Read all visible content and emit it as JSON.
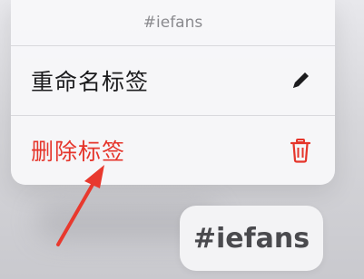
{
  "menu": {
    "header": "#iefans",
    "rename_label": "重命名标签",
    "rename_icon": "pencil-icon",
    "delete_label": "删除标签",
    "delete_icon": "trash-icon"
  },
  "tag_chip": {
    "label": "#iefans"
  },
  "colors": {
    "destructive": "#e5352b",
    "primary_text": "#1c1c1e",
    "secondary_text": "#8a8a8e",
    "annotation_arrow": "#e8392e"
  }
}
